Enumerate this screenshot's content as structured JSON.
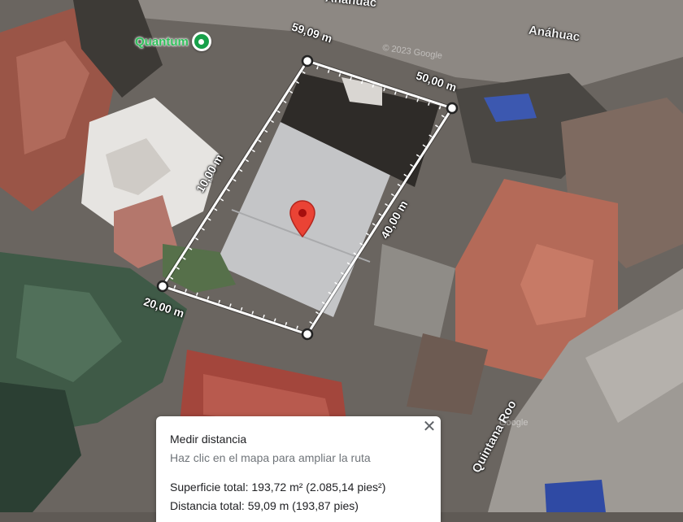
{
  "map": {
    "poi": {
      "label": "Quantum",
      "icon": "place-marker-icon",
      "color": "#18a04a"
    },
    "streets": [
      "Anáhuac",
      "Anáhuac",
      "Quintana Roo"
    ],
    "watermarks": [
      "© 2023 Google",
      "Google"
    ],
    "measurement": {
      "segment_labels": [
        "59,09 m",
        "50,00 m",
        "10,00 m",
        "40,00 m",
        "20,00 m"
      ],
      "line_color": "#ffffff",
      "vertex_icon": "measure-vertex-icon"
    },
    "pin": {
      "icon": "red-location-pin-icon",
      "color": "#ea4335"
    }
  },
  "measure_card": {
    "title": "Medir distancia",
    "hint": "Haz clic en el mapa para ampliar la ruta",
    "area": "Superficie total: 193,72 m² (2.085,14 pies²)",
    "distance": "Distancia total: 59,09 m (193,87 pies)",
    "close_icon": "close-icon"
  }
}
